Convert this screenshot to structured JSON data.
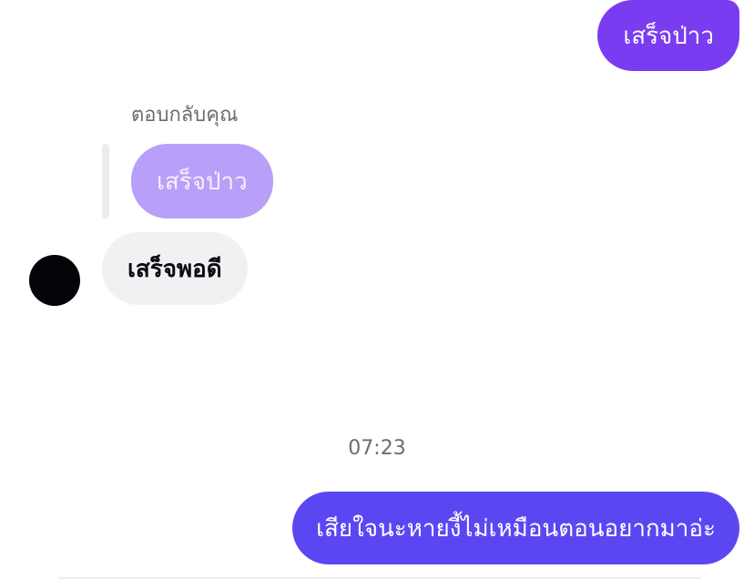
{
  "messages": {
    "outgoing_top": "เสร็จป่าว",
    "reply_label": "ตอบกลับคุณ",
    "replied_message": "เสร็จป่าว",
    "incoming": "เสร็จพอดี",
    "timestamp": "07:23",
    "outgoing_bottom": "เสียใจนะหายงี้ไม่เหมือนตอนอยากมาอ่ะ"
  },
  "colors": {
    "outgoing_top_bubble": "#7a3cf0",
    "reply_bubble": "#b8a0f8",
    "incoming_bubble": "#f1f1f4",
    "outgoing_bottom_bubble": "#5b47f2",
    "avatar": "#060308"
  }
}
